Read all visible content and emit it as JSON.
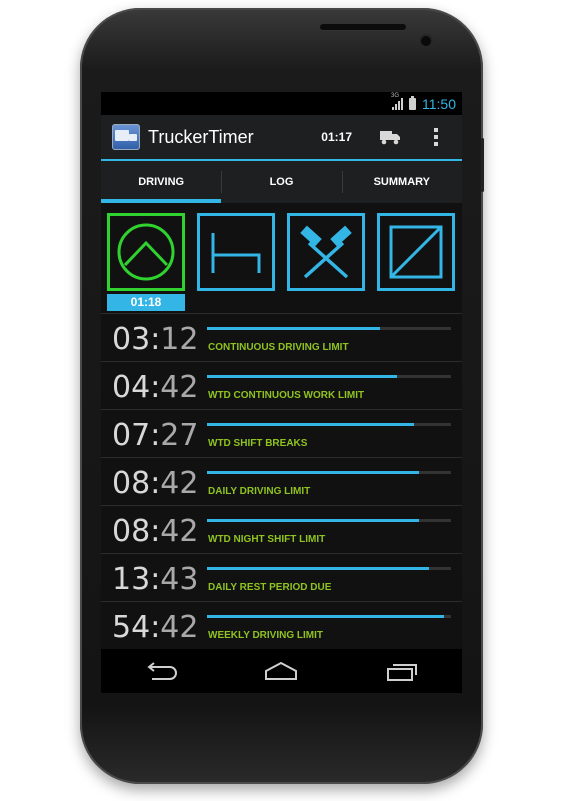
{
  "status_bar": {
    "network": "3G",
    "time": "11:50",
    "icons": [
      "signal-icon",
      "battery-charging-icon"
    ]
  },
  "action_bar": {
    "app_icon": "truck-app-icon",
    "title": "TruckerTimer",
    "timer": "01:17",
    "truck_icon": "truck-icon",
    "overflow_icon": "overflow-menu-icon"
  },
  "tabs": [
    {
      "label": "DRIVING",
      "active": true
    },
    {
      "label": "LOG",
      "active": false
    },
    {
      "label": "SUMMARY",
      "active": false
    }
  ],
  "modes": [
    {
      "name": "driving",
      "icon": "steering-wheel-icon",
      "active": true,
      "time": "01:18"
    },
    {
      "name": "rest",
      "icon": "bed-icon",
      "active": false
    },
    {
      "name": "work",
      "icon": "crossed-hammers-icon",
      "active": false
    },
    {
      "name": "availability",
      "icon": "diagonal-box-icon",
      "active": false
    }
  ],
  "limits": [
    {
      "hours": "03",
      "minutes": "12",
      "label": "CONTINUOUS DRIVING LIMIT",
      "progress": 0.71
    },
    {
      "hours": "04",
      "minutes": "42",
      "label": "WTD CONTINUOUS WORK LIMIT",
      "progress": 0.78
    },
    {
      "hours": "07",
      "minutes": "27",
      "label": "WTD SHIFT BREAKS",
      "progress": 0.85
    },
    {
      "hours": "08",
      "minutes": "42",
      "label": "DAILY DRIVING LIMIT",
      "progress": 0.87
    },
    {
      "hours": "08",
      "minutes": "42",
      "label": "WTD NIGHT SHIFT LIMIT",
      "progress": 0.87
    },
    {
      "hours": "13",
      "minutes": "43",
      "label": "DAILY REST PERIOD DUE",
      "progress": 0.91
    },
    {
      "hours": "54",
      "minutes": "42",
      "label": "WEEKLY DRIVING LIMIT",
      "progress": 0.97
    }
  ],
  "nav_bar": [
    "back-icon",
    "home-icon",
    "recent-apps-icon"
  ],
  "colors": {
    "accent": "#33b5e5",
    "active_mode": "#2fd22f",
    "label_green": "#8fc31f",
    "background": "#111111"
  }
}
